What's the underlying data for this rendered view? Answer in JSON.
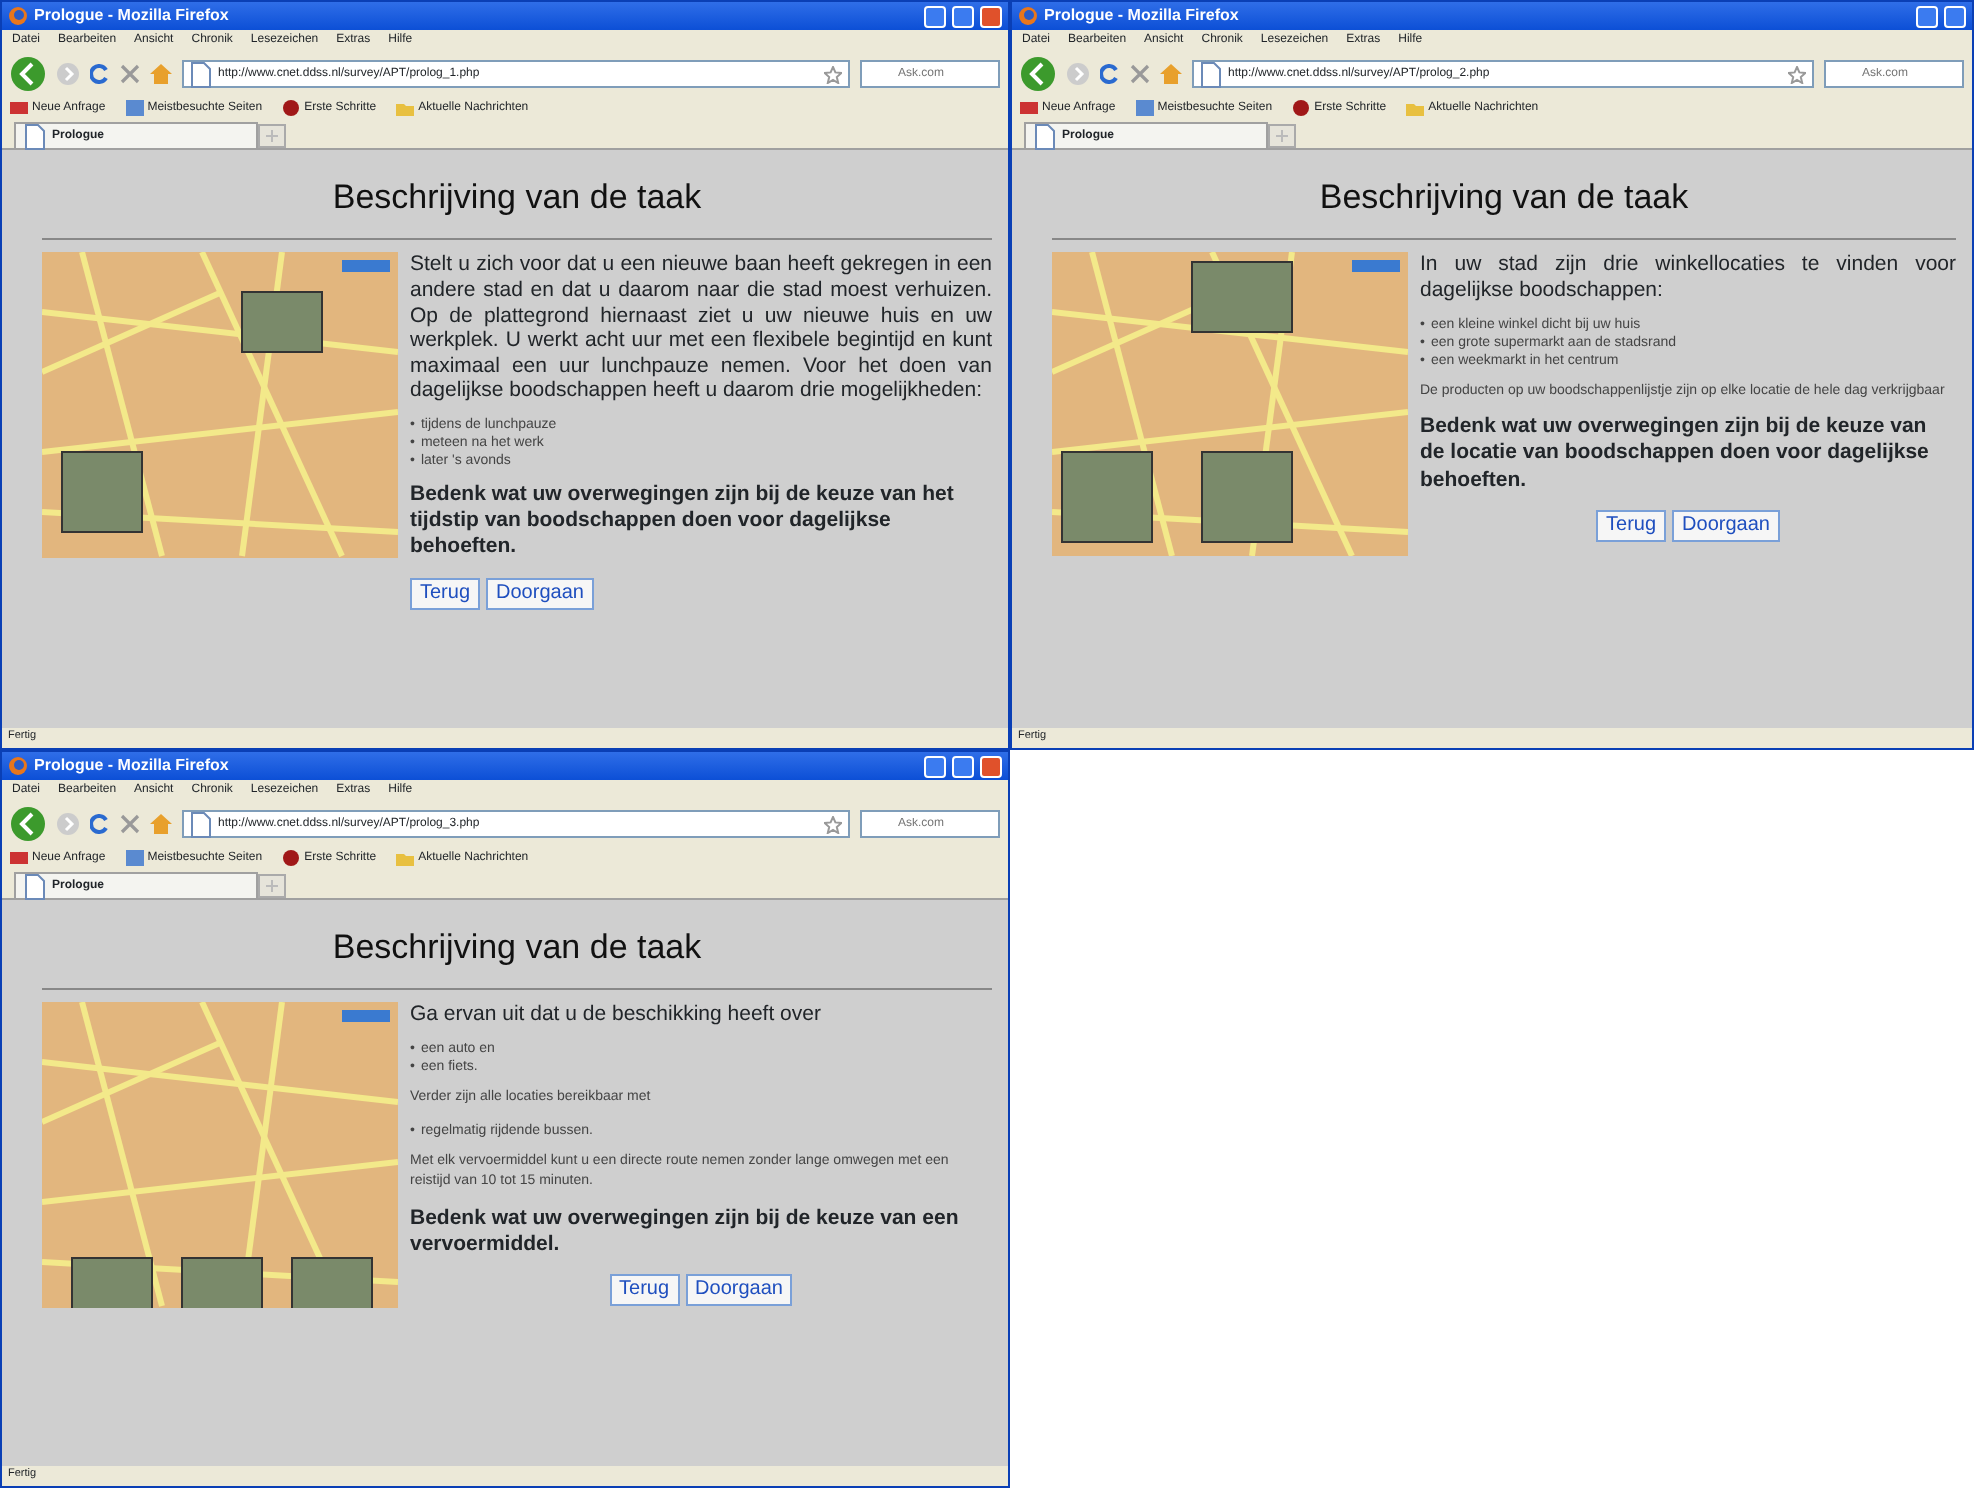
{
  "windows": [
    {
      "title": "Prologue - Mozilla Firefox",
      "close_visible": true,
      "menu": [
        "Datei",
        "Bearbeiten",
        "Ansicht",
        "Chronik",
        "Lesezeichen",
        "Extras",
        "Hilfe"
      ],
      "url": "http://www.cnet.ddss.nl/survey/APT/prolog_1.php",
      "search": {
        "placeholder": "Ask.com"
      },
      "bookmarks": [
        "Neue Anfrage",
        "Meistbesuchte Seiten",
        "Erste Schritte",
        "Aktuelle Nachrichten"
      ],
      "tab": "Prologue",
      "heading": "Beschrijving van de taak",
      "blocks": [
        {
          "kind": "lead",
          "text": "Stelt u zich voor dat u een nieuwe baan heeft gekregen in een andere stad en dat u daarom naar die stad moest verhuizen. Op de plattegrond hiernaast ziet u uw nieuwe huis en uw werkplek. U werkt acht uur met een flexibele begintijd en kunt maximaal een uur lunchpauze nemen. Voor het doen van dagelijkse boodschappen heeft u daarom drie mogelijkheden:"
        },
        {
          "kind": "list",
          "marker": "•",
          "items": [
            "tijdens de lunchpauze",
            "meteen na het werk",
            "later 's avonds"
          ]
        },
        {
          "kind": "question",
          "text": "Bedenk wat uw overwegingen zijn bij de keuze van het tijdstip van boodschappen doen voor dagelijkse behoeften."
        }
      ],
      "buttons": [
        "Terug",
        "Doorgaan"
      ],
      "buttons_centered": false,
      "status": "Fertig"
    },
    {
      "title": "Prologue - Mozilla Firefox",
      "close_visible": false,
      "menu": [
        "Datei",
        "Bearbeiten",
        "Ansicht",
        "Chronik",
        "Lesezeichen",
        "Extras",
        "Hilfe"
      ],
      "url": "http://www.cnet.ddss.nl/survey/APT/prolog_2.php",
      "search": {
        "placeholder": "Ask.com"
      },
      "bookmarks": [
        "Neue Anfrage",
        "Meistbesuchte Seiten",
        "Erste Schritte",
        "Aktuelle Nachrichten"
      ],
      "tab": "Prologue",
      "heading": "Beschrijving van de taak",
      "blocks": [
        {
          "kind": "lead",
          "text": "In uw stad zijn drie winkellocaties te vinden voor dagelijkse boodschappen:"
        },
        {
          "kind": "list",
          "marker": "•",
          "items": [
            "een kleine winkel dicht bij uw huis",
            "een grote supermarkt aan de stadsrand",
            "een weekmarkt in het centrum"
          ]
        },
        {
          "kind": "note",
          "text": "De producten op uw boodschappenlijstje zijn op elke locatie de hele dag verkrijgbaar"
        },
        {
          "kind": "question",
          "text": "Bedenk wat uw overwegingen zijn bij de keuze van de locatie van boodschappen doen voor dagelijkse behoeften."
        }
      ],
      "buttons": [
        "Terug",
        "Doorgaan"
      ],
      "buttons_centered": true,
      "status": "Fertig"
    },
    {
      "title": "Prologue - Mozilla Firefox",
      "close_visible": true,
      "menu": [
        "Datei",
        "Bearbeiten",
        "Ansicht",
        "Chronik",
        "Lesezeichen",
        "Extras",
        "Hilfe"
      ],
      "url": "http://www.cnet.ddss.nl/survey/APT/prolog_3.php",
      "search": {
        "placeholder": "Ask.com"
      },
      "bookmarks": [
        "Neue Anfrage",
        "Meistbesuchte Seiten",
        "Erste Schritte",
        "Aktuelle Nachrichten"
      ],
      "tab": "Prologue",
      "heading": "Beschrijving van de taak",
      "blocks": [
        {
          "kind": "lead",
          "text": "Ga ervan uit dat u de beschikking heeft over"
        },
        {
          "kind": "list",
          "marker": "•",
          "items": [
            "een auto en",
            "een fiets."
          ]
        },
        {
          "kind": "note",
          "text": "Verder zijn alle locaties bereikbaar met"
        },
        {
          "kind": "list",
          "marker": "•",
          "items": [
            "regelmatig rijdende bussen."
          ]
        },
        {
          "kind": "note",
          "text": "Met elk vervoermiddel kunt u een directe route nemen zonder lange omwegen met een reistijd van 10 tot 15 minuten."
        },
        {
          "kind": "question",
          "text": "Bedenk wat uw overwegingen zijn bij de keuze van een vervoermiddel."
        }
      ],
      "buttons": [
        "Terug",
        "Doorgaan"
      ],
      "buttons_centered": true,
      "status": "Fertig"
    }
  ]
}
